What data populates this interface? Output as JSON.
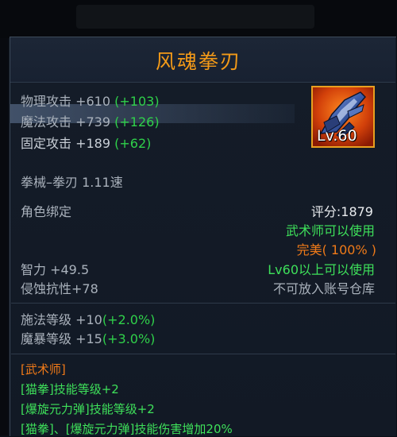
{
  "item": {
    "name": "风魂拳刃",
    "level_badge": "Lv.60",
    "icon": "fist-blade-icon",
    "stats": [
      {
        "label": "物理攻击 +610",
        "bonus": "(+103)"
      },
      {
        "label": "魔法攻击 +739",
        "bonus": "(+126)"
      },
      {
        "label": "固定攻击 +189",
        "bonus": "(+62)"
      }
    ],
    "weapon_type": "拳械–拳刃  1.11速",
    "binding": "角色绑定",
    "score": "评分:1879",
    "class_req": "武术师可以使用",
    "quality": "完美( 100% )",
    "int_stat": "智力 +49.5",
    "level_req": "Lv60以上可以使用",
    "corrosion": "侵蚀抗性+78",
    "storage": "不可放入账号仓库",
    "cast_level": {
      "label": "施法等级 +10",
      "bonus": "(+2.0%)"
    },
    "crit_level": {
      "label": "魔暴等级 +15",
      "bonus": "(+3.0%)"
    },
    "class_section": "[武术师]",
    "skill_lines": [
      "[猫拳]技能等级+2",
      "[爆旋元力弹]技能等级+2",
      "[猫拳]、[爆旋元力弹]技能伤害增加20%"
    ]
  },
  "colors": {
    "title": "#f39a18",
    "bonus_green": "#2fd14a",
    "quality_orange": "#f07a18"
  }
}
